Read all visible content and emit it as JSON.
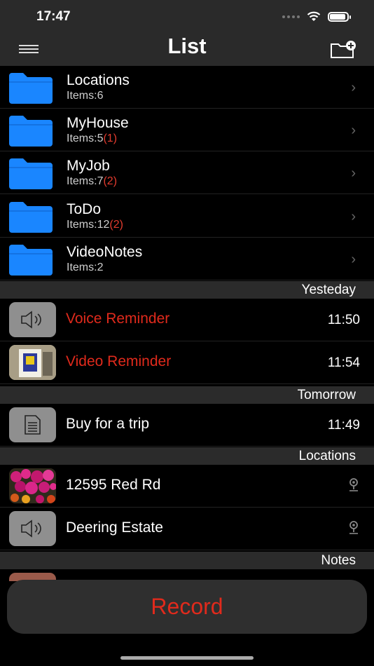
{
  "status": {
    "time": "17:47"
  },
  "nav": {
    "title": "List"
  },
  "folders": [
    {
      "name": "Locations",
      "count": "Items:6",
      "badge": ""
    },
    {
      "name": "MyHouse",
      "count": "Items:5",
      "badge": "(1)"
    },
    {
      "name": "MyJob",
      "count": "Items:7",
      "badge": "(2)"
    },
    {
      "name": "ToDo",
      "count": "Items:12",
      "badge": "(2)"
    },
    {
      "name": "VideoNotes",
      "count": "Items:2",
      "badge": ""
    }
  ],
  "sections": {
    "yesterday": {
      "label": "Yesteday",
      "items": [
        {
          "title": "Voice  Reminder",
          "time": "11:50",
          "icon": "speaker-icon"
        },
        {
          "title": "Video  Reminder",
          "time": "11:54",
          "icon": "video-thumbnail"
        }
      ]
    },
    "tomorrow": {
      "label": "Tomorrow",
      "items": [
        {
          "title": "Buy for a trip",
          "time": "11:49",
          "icon": "document-icon"
        }
      ]
    },
    "locations": {
      "label": "Locations",
      "items": [
        {
          "title": "12595 Red Rd",
          "icon": "flower-photo-thumbnail"
        },
        {
          "title": "Deering Estate",
          "icon": "speaker-icon"
        }
      ]
    },
    "notes": {
      "label": "Notes"
    }
  },
  "record": {
    "label": "Record"
  },
  "colors": {
    "accent_red": "#e02a1c",
    "folder_blue": "#1a86ff"
  }
}
